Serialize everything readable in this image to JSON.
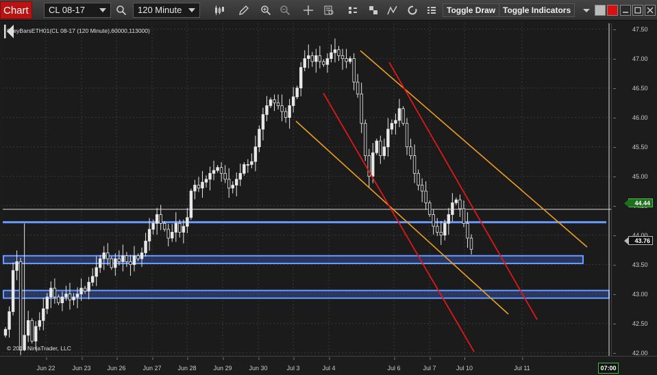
{
  "toolbar": {
    "chart_tab": "Chart",
    "instrument": "CL 08-17",
    "interval": "120 Minute",
    "toggle_draw": "Toggle Draw",
    "toggle_indicators": "Toggle Indicators",
    "icons": [
      "search-icon",
      "bars-style-icon",
      "pencil-icon",
      "zoom-in-icon",
      "zoom-out-icon",
      "crosshair-icon",
      "data-box-icon",
      "bar-period-icon",
      "stack-icon",
      "draw-lines-icon",
      "refresh-icon",
      "list-icon"
    ]
  },
  "chart": {
    "series_label": "GreyBarsETH01(CL 08-17 (120 Minute),60000,113000)",
    "copyright": "© 2017 NinjaTrader, LLC",
    "price_ticks": [
      "47.50",
      "47.00",
      "46.50",
      "46.00",
      "45.50",
      "45.00",
      "44.50",
      "44.00",
      "43.50",
      "43.00",
      "42.50",
      "42.00"
    ],
    "horizontal_line_price": "44.44",
    "last_price": "43.76",
    "time_ticks": [
      "Jun 22",
      "Jun 23",
      "Jun 26",
      "Jun 27",
      "Jun 28",
      "Jun 29",
      "Jun 30",
      "Jul 3",
      "Jul 4",
      "Jul 6",
      "Jul 7",
      "Jul 10",
      "Jul 11"
    ],
    "time_badge": "07:00",
    "colors": {
      "background": "#1b1b1b",
      "grid": "#3a3a3a",
      "candle": "#e8e8e8",
      "zone": "#6b9cff",
      "orange_channel": "#f0a020",
      "red_channel": "#e01818",
      "cursor_line": "#e0e0e0"
    }
  },
  "chart_data": {
    "type": "candlestick",
    "ylim": [
      41.95,
      47.6
    ],
    "grid": true,
    "closes": [
      42.4,
      42.7,
      43.4,
      43.55,
      42.05,
      42.3,
      42.55,
      42.2,
      42.45,
      42.55,
      42.75,
      42.95,
      43.1,
      42.95,
      42.85,
      42.95,
      43.0,
      42.9,
      42.95,
      43.0,
      43.1,
      43.05,
      43.2,
      43.3,
      43.45,
      43.6,
      43.7,
      43.6,
      43.45,
      43.6,
      43.55,
      43.65,
      43.55,
      43.5,
      43.65,
      43.6,
      43.7,
      43.9,
      44.1,
      44.2,
      44.35,
      44.2,
      44.1,
      43.95,
      44.05,
      44.2,
      44.05,
      44.15,
      44.3,
      44.75,
      44.85,
      44.8,
      44.9,
      44.95,
      45.05,
      45.1,
      45.15,
      45.05,
      44.95,
      44.8,
      44.85,
      44.95,
      45.05,
      45.2,
      45.2,
      45.25,
      45.5,
      45.8,
      46.05,
      46.2,
      46.3,
      46.25,
      46.2,
      46.1,
      46.0,
      46.2,
      46.35,
      46.5,
      46.85,
      47.0,
      47.05,
      46.95,
      47.05,
      46.95,
      46.9,
      47.0,
      47.1,
      47.15,
      47.05,
      47.0,
      46.95,
      47.0,
      46.6,
      46.4,
      45.9,
      45.35,
      45.0,
      45.4,
      45.6,
      45.35,
      45.5,
      45.8,
      45.9,
      45.95,
      46.15,
      45.9,
      45.5,
      45.35,
      45.05,
      44.85,
      44.75,
      44.55,
      44.35,
      44.15,
      44.05,
      44.0,
      44.2,
      44.35,
      44.55,
      44.6,
      44.45,
      44.2,
      43.95,
      43.76
    ],
    "levels": [
      {
        "price": 44.44,
        "label": "44.44"
      },
      {
        "price": 44.22,
        "label": "zone-top"
      },
      {
        "price_top": 43.65,
        "price_bottom": 43.52,
        "label": "zone-mid"
      },
      {
        "price_top": 43.06,
        "price_bottom": 42.93,
        "label": "zone-low"
      }
    ]
  }
}
